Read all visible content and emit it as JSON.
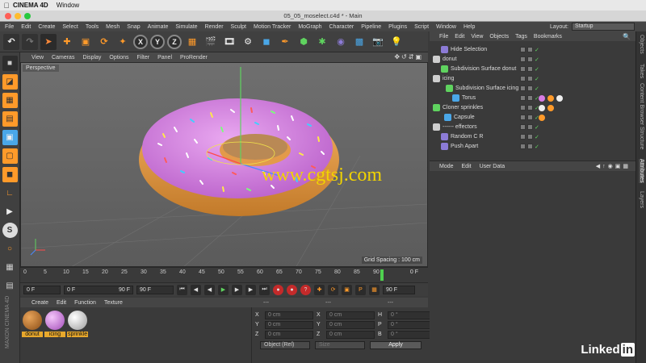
{
  "mac": {
    "app_name": "CINEMA 4D",
    "menu_window": "Window"
  },
  "window": {
    "title": "05_05_moselect.c4d * - Main"
  },
  "main_menu": [
    "File",
    "Edit",
    "Create",
    "Select",
    "Tools",
    "Mesh",
    "Snap",
    "Animate",
    "Simulate",
    "Render",
    "Sculpt",
    "Motion Tracker",
    "MoGraph",
    "Character",
    "Pipeline",
    "Plugins",
    "Script",
    "Window",
    "Help"
  ],
  "layout": {
    "label": "Layout:",
    "value": "Startup"
  },
  "toolbar": {
    "x": "X",
    "y": "Y",
    "z": "Z"
  },
  "viewport": {
    "menu": [
      "View",
      "Cameras",
      "Display",
      "Options",
      "Filter",
      "Panel",
      "ProRender"
    ],
    "label": "Perspective",
    "grid_spacing": "Grid Spacing : 100 cm",
    "watermark": "www.cgtsj.com"
  },
  "timeline": {
    "ticks": [
      "0",
      "5",
      "10",
      "15",
      "20",
      "25",
      "30",
      "35",
      "40",
      "45",
      "50",
      "55",
      "60",
      "65",
      "70",
      "75",
      "80",
      "85",
      "90"
    ],
    "frame": "0 F",
    "current_frame": 89
  },
  "transport": {
    "start": "0 F",
    "min": "0 F",
    "max": "90 F",
    "end": "90 F",
    "range_end": "90 F"
  },
  "materials": {
    "menu": [
      "Create",
      "Edit",
      "Function",
      "Texture"
    ],
    "items": [
      {
        "name": "donut",
        "color": "#b5722c"
      },
      {
        "name": "icing",
        "color": "#d77be4"
      },
      {
        "name": "sprinkle",
        "color": "#e6e6e6"
      }
    ]
  },
  "coordinates": {
    "headers": [
      "---",
      "---",
      "---"
    ],
    "rows": [
      {
        "a": "X",
        "av": "0 cm",
        "b": "X",
        "bv": "0 cm",
        "c": "H",
        "cv": "0 °"
      },
      {
        "a": "Y",
        "av": "0 cm",
        "b": "Y",
        "bv": "0 cm",
        "c": "P",
        "cv": "0 °"
      },
      {
        "a": "Z",
        "av": "0 cm",
        "b": "Z",
        "bv": "0 cm",
        "c": "B",
        "cv": "0 °"
      }
    ],
    "mode": "Object (Rel)",
    "size": "Size",
    "apply": "Apply"
  },
  "object_manager": {
    "menu": [
      "File",
      "Edit",
      "View",
      "Objects",
      "Tags",
      "Bookmarks"
    ],
    "objects": [
      {
        "name": "Hide Selection",
        "indent": 1,
        "color": "#8c7bd6"
      },
      {
        "name": "donut",
        "indent": 0,
        "color": "#cfcfcf"
      },
      {
        "name": "Subdivision Surface donut",
        "indent": 1,
        "color": "#5fd35f"
      },
      {
        "name": "icing",
        "indent": 0,
        "color": "#cfcfcf"
      },
      {
        "name": "Subdivision Surface icing",
        "indent": 1,
        "color": "#5fd35f"
      },
      {
        "name": "Torus",
        "indent": 2,
        "color": "#4aa7e8"
      },
      {
        "name": "Cloner sprinkles",
        "indent": 0,
        "color": "#5fd35f"
      },
      {
        "name": "Capsule",
        "indent": 1,
        "color": "#4aa7e8"
      },
      {
        "name": "------ effectors",
        "indent": 0,
        "color": "#cfcfcf"
      },
      {
        "name": "Random C R",
        "indent": 1,
        "color": "#8c7bd6"
      },
      {
        "name": "Push Apart",
        "indent": 1,
        "color": "#8c7bd6"
      }
    ]
  },
  "attributes": {
    "menu": [
      "Mode",
      "Edit",
      "User Data"
    ]
  },
  "side_tabs": [
    "Objects",
    "Takes",
    "Content Browser",
    "Structure",
    "Attributes",
    "Layers"
  ],
  "linkedin": {
    "text": "Linked",
    "badge": "in"
  },
  "maxon": "MAXON CINEMA 4D"
}
